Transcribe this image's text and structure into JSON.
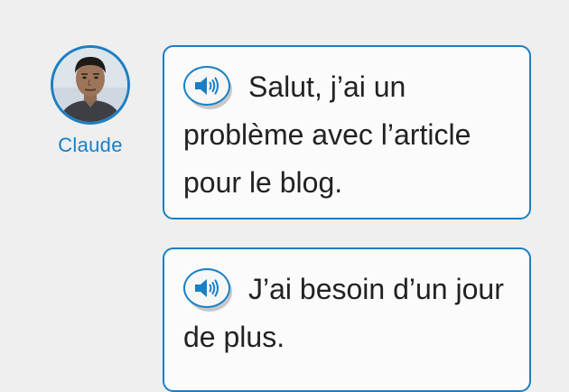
{
  "speaker": {
    "name": "Claude"
  },
  "messages": [
    {
      "text": "Salut, j’ai un problème avec l’article pour le blog."
    },
    {
      "text": "J’ai besoin d’un jour de plus."
    }
  ],
  "colors": {
    "accent": "#1a7fc4",
    "background": "#efefef",
    "bubble": "#fbfbfb",
    "text": "#222222"
  },
  "icons": {
    "play": "speaker-icon"
  }
}
